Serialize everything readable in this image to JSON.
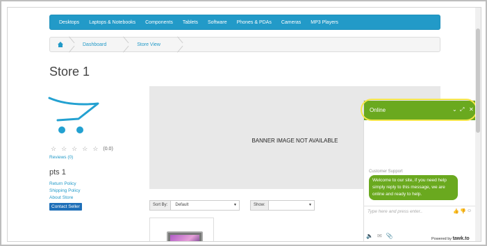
{
  "menu": {
    "items": [
      "Desktops",
      "Laptops & Notebooks",
      "Components",
      "Tablets",
      "Software",
      "Phones & PDAs",
      "Cameras",
      "MP3 Players"
    ]
  },
  "breadcrumb": {
    "items": [
      "Dashboard",
      "Store View"
    ]
  },
  "store": {
    "title": "Store 1",
    "rating_text": "(0.0)",
    "rating_stars": 0,
    "reviews": "Reviews (0)",
    "seller_name": "pts 1",
    "links": [
      "Return Policy",
      "Shipping Policy",
      "About Store"
    ],
    "contact_button": "Contact Seller"
  },
  "banner": {
    "text": "BANNER IMAGE NOT AVAILABLE"
  },
  "controls": {
    "sort_label": "Sort By:",
    "sort_value": "Default",
    "show_label": "Show:",
    "show_value": ""
  },
  "chat": {
    "status": "Online",
    "agent": "Customer Support",
    "message": "Welcome to our site, if you need help simply reply to this message, we are online and ready to help.",
    "input_placeholder": "Type here and press enter..",
    "powered_by": "Powered by",
    "brand": "tawk.to"
  },
  "colors": {
    "menu_bg": "#229ac8",
    "link": "#229ac8",
    "chat_green": "#6aa91f",
    "highlight": "#f5e64a"
  }
}
